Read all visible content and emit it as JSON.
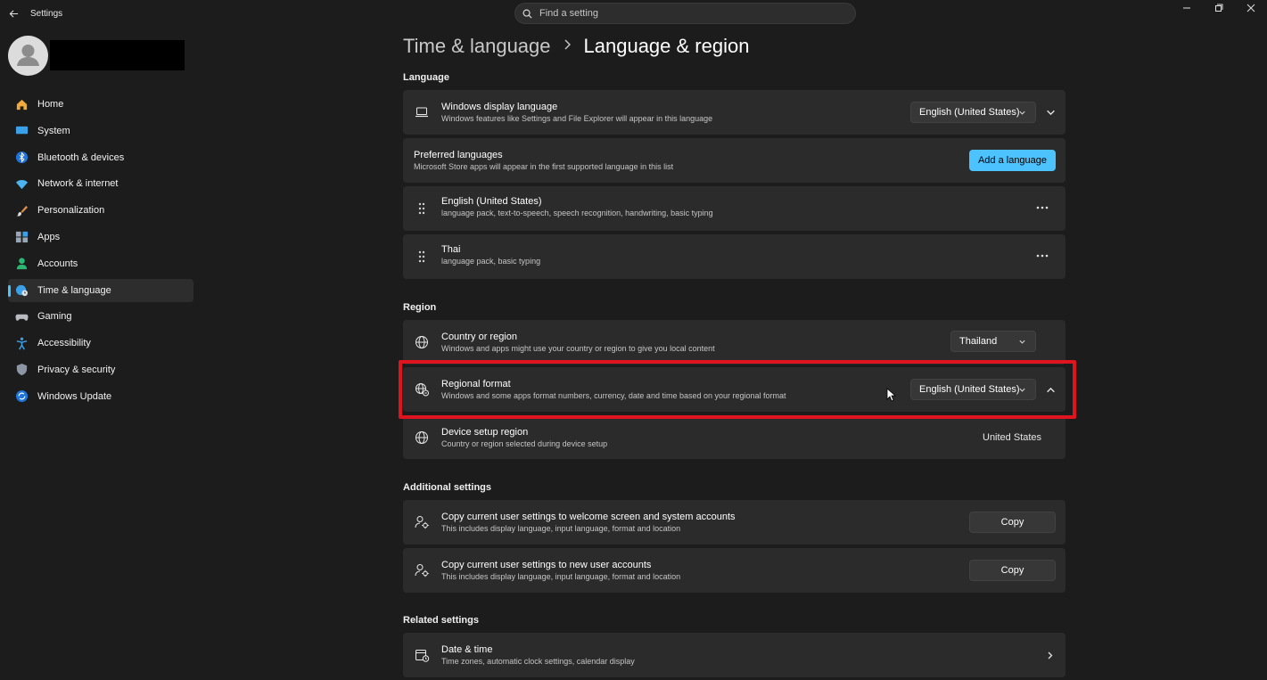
{
  "window": {
    "app_title": "Settings",
    "back_icon": "back-arrow-icon",
    "controls": [
      "minimize-icon",
      "restore-icon",
      "close-icon"
    ]
  },
  "search": {
    "placeholder": "Find a setting"
  },
  "nav": {
    "items": [
      {
        "label": "Home",
        "icon": "home-icon"
      },
      {
        "label": "System",
        "icon": "system-icon"
      },
      {
        "label": "Bluetooth & devices",
        "icon": "bluetooth-icon"
      },
      {
        "label": "Network & internet",
        "icon": "wifi-icon"
      },
      {
        "label": "Personalization",
        "icon": "brush-icon"
      },
      {
        "label": "Apps",
        "icon": "apps-icon"
      },
      {
        "label": "Accounts",
        "icon": "accounts-icon"
      },
      {
        "label": "Time & language",
        "icon": "globe-clock-icon",
        "active": true
      },
      {
        "label": "Gaming",
        "icon": "gamepad-icon"
      },
      {
        "label": "Accessibility",
        "icon": "accessibility-icon"
      },
      {
        "label": "Privacy & security",
        "icon": "shield-icon"
      },
      {
        "label": "Windows Update",
        "icon": "update-icon"
      }
    ]
  },
  "header": {
    "parent": "Time & language",
    "current": "Language & region"
  },
  "language": {
    "section_title": "Language",
    "display": {
      "title": "Windows display language",
      "desc": "Windows features like Settings and File Explorer will appear in this language",
      "value": "English (United States)"
    },
    "preferred": {
      "title": "Preferred languages",
      "desc": "Microsoft Store apps will appear in the first supported language in this list",
      "button": "Add a language"
    },
    "entries": [
      {
        "title": "English (United States)",
        "desc": "language pack, text-to-speech, speech recognition, handwriting, basic typing"
      },
      {
        "title": "Thai",
        "desc": "language pack, basic typing"
      }
    ]
  },
  "region": {
    "section_title": "Region",
    "country": {
      "title": "Country or region",
      "desc": "Windows and apps might use your country or region to give you local content",
      "value": "Thailand"
    },
    "format": {
      "title": "Regional format",
      "desc": "Windows and some apps format numbers, currency, date and time based on your regional format",
      "value": "English (United States)"
    },
    "device": {
      "title": "Device setup region",
      "desc": "Country or region selected during device setup",
      "value": "United States"
    }
  },
  "additional": {
    "section_title": "Additional settings",
    "items": [
      {
        "title": "Copy current user settings to welcome screen and system accounts",
        "desc": "This includes display language, input language, format and location",
        "button": "Copy"
      },
      {
        "title": "Copy current user settings to new user accounts",
        "desc": "This includes display language, input language, format and location",
        "button": "Copy"
      }
    ]
  },
  "related": {
    "section_title": "Related settings",
    "date_time": {
      "title": "Date & time",
      "desc": "Time zones, automatic clock settings, calendar display"
    }
  },
  "colors": {
    "accent": "#4cc2ff",
    "highlight": "#e0141e",
    "background": "#1c1c1c",
    "card": "#2b2b2b"
  }
}
